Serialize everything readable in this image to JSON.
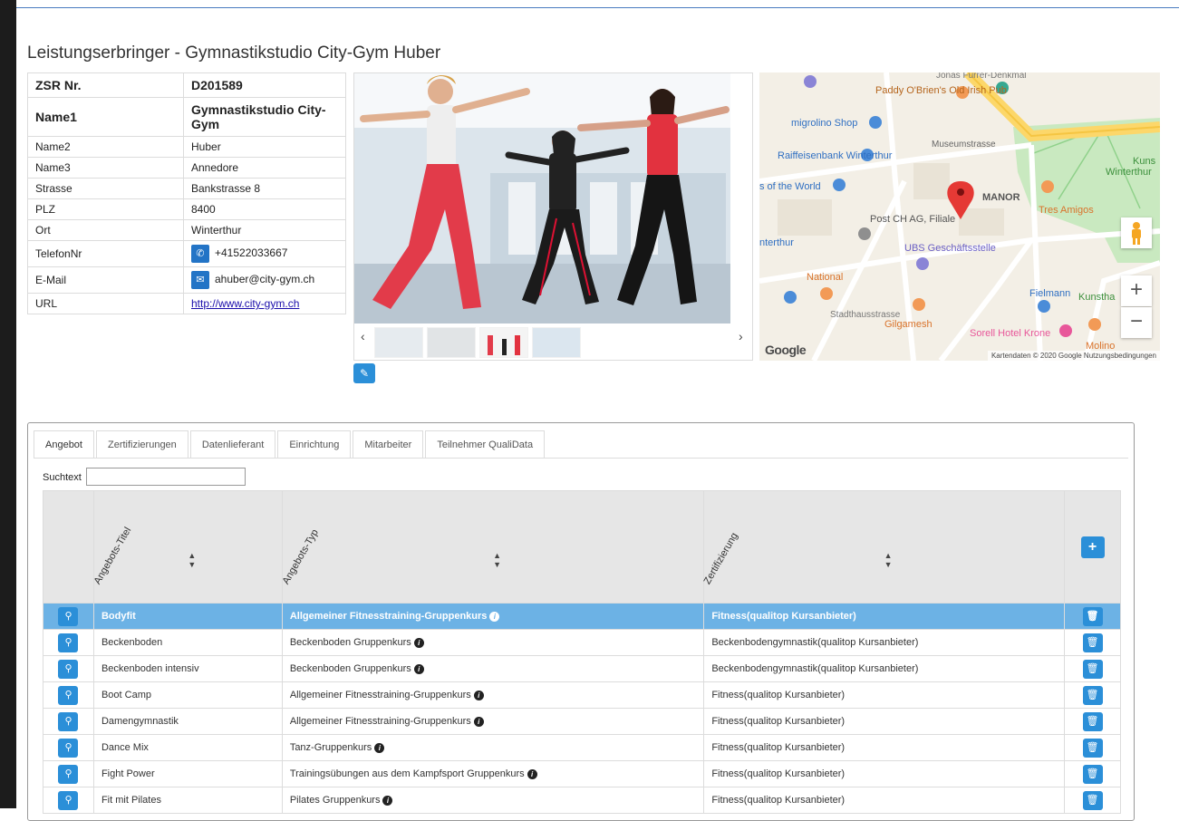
{
  "page": {
    "title": "Leistungserbringer - Gymnastikstudio City-Gym Huber"
  },
  "info": {
    "rows": [
      {
        "key": "ZSR Nr.",
        "value": "D201589"
      },
      {
        "key": "Name1",
        "value": "Gymnastikstudio City-Gym"
      },
      {
        "key": "Name2",
        "value": "Huber"
      },
      {
        "key": "Name3",
        "value": "Annedore"
      },
      {
        "key": "Strasse",
        "value": "Bankstrasse 8"
      },
      {
        "key": "PLZ",
        "value": "8400"
      },
      {
        "key": "Ort",
        "value": "Winterthur"
      },
      {
        "key": "TelefonNr",
        "value": "+41522033667"
      },
      {
        "key": "E-Mail",
        "value": "ahuber@city-gym.ch"
      },
      {
        "key": "URL",
        "value": "http://www.city-gym.ch"
      }
    ]
  },
  "gallery": {
    "prev": "‹",
    "next": "›"
  },
  "map": {
    "labels": {
      "irish_pub": "Paddy O'Brien's Old Irish Pub",
      "migrolino": "migrolino Shop",
      "raiffeisen": "Raiffeisenbank Winterthur",
      "museum": "Museumstrasse",
      "world": "s of the World",
      "manor": "MANOR",
      "post": "Post CH AG, Filiale",
      "ubs": "UBS Geschäftsstelle",
      "tres": "Tres Amigos",
      "national": "National",
      "fielmann": "Fielmann",
      "stadthaus": "Stadthausstrasse",
      "gilgamesh": "Gilgamesh",
      "sorell": "Sorell Hotel Krone",
      "jonas": "Jonas Furrer-Denkmal",
      "kunst": "Kuns",
      "kunsthalle": "Kunstha",
      "winterthur_right": "Winterthur",
      "interthur": "nterthur",
      "molino": "Molino"
    },
    "zoom_in": "+",
    "zoom_out": "−",
    "google": "Google",
    "copyright": "Kartendaten © 2020 Google   Nutzungsbedingungen"
  },
  "tabs": [
    {
      "label": "Angebot",
      "active": true
    },
    {
      "label": "Zertifizierungen",
      "active": false
    },
    {
      "label": "Datenlieferant",
      "active": false
    },
    {
      "label": "Einrichtung",
      "active": false
    },
    {
      "label": "Mitarbeiter",
      "active": false
    },
    {
      "label": "Teilnehmer QualiData",
      "active": false
    }
  ],
  "search": {
    "label": "Suchtext",
    "value": ""
  },
  "grid": {
    "columns": [
      "Angebots-Titel",
      "Angebots-Typ",
      "Zertifizierung"
    ],
    "add_label": "+",
    "rows": [
      {
        "title": "Bodyfit",
        "type": "Allgemeiner Fitnesstraining-Gruppenkurs",
        "cert": "Fitness(qualitop Kursanbieter)",
        "selected": true
      },
      {
        "title": "Beckenboden",
        "type": "Beckenboden Gruppenkurs",
        "cert": "Beckenbodengymnastik(qualitop Kursanbieter)"
      },
      {
        "title": "Beckenboden intensiv",
        "type": "Beckenboden Gruppenkurs",
        "cert": "Beckenbodengymnastik(qualitop Kursanbieter)"
      },
      {
        "title": "Boot Camp",
        "type": "Allgemeiner Fitnesstraining-Gruppenkurs",
        "cert": "Fitness(qualitop Kursanbieter)"
      },
      {
        "title": "Damengymnastik",
        "type": "Allgemeiner Fitnesstraining-Gruppenkurs",
        "cert": "Fitness(qualitop Kursanbieter)"
      },
      {
        "title": "Dance Mix",
        "type": "Tanz-Gruppenkurs",
        "cert": "Fitness(qualitop Kursanbieter)"
      },
      {
        "title": "Fight Power",
        "type": "Trainingsübungen aus dem Kampfsport Gruppenkurs",
        "cert": "Fitness(qualitop Kursanbieter)"
      },
      {
        "title": "Fit mit Pilates",
        "type": "Pilates Gruppenkurs",
        "cert": "Fitness(qualitop Kursanbieter)"
      }
    ]
  },
  "colors": {
    "accent": "#2b8fd8",
    "selected_row": "#6cb2e5",
    "contact_icon": "#2374c6"
  }
}
